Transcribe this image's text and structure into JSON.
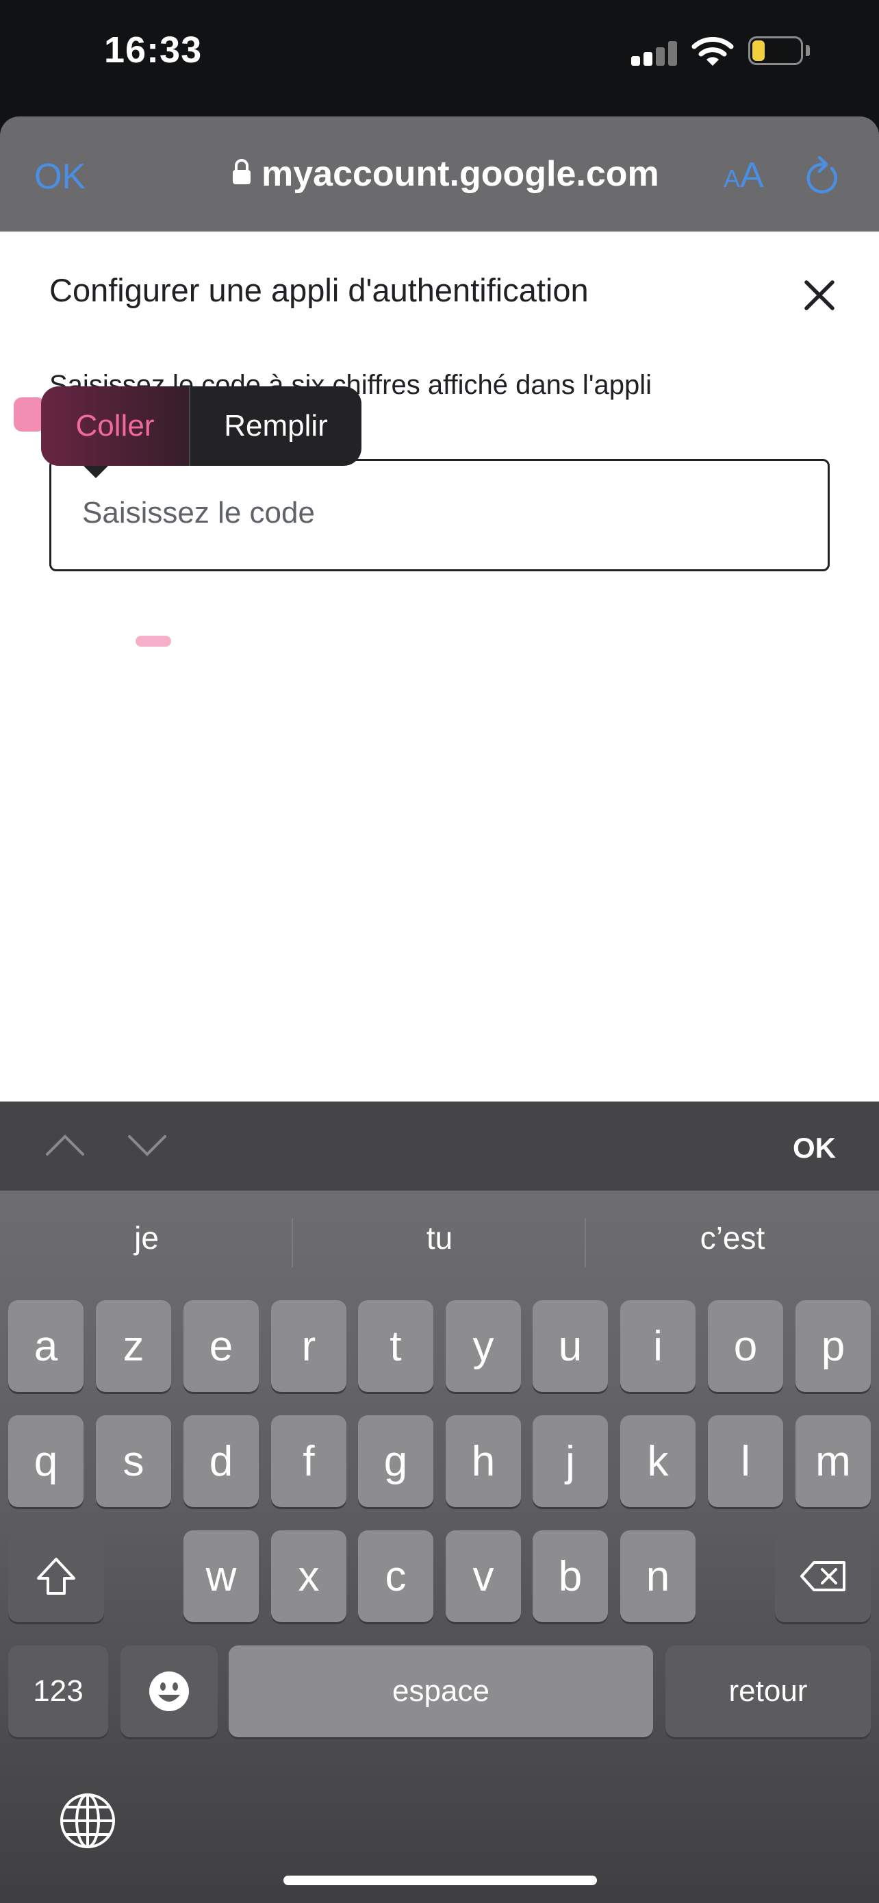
{
  "status_bar": {
    "time": "16:33",
    "battery_level": "8",
    "signal_bars_filled": 2,
    "signal_bars_total": 4
  },
  "browser": {
    "done_label": "OK",
    "url": "myaccount.google.com",
    "reader_label": "AA",
    "accent_color": "#4a8fe3"
  },
  "dialog": {
    "title": "Configurer une appli d'authentification",
    "description": "Saisissez le code à six chiffres affiché dans l'appli",
    "code_input": {
      "value": "",
      "placeholder": "Saisissez le code"
    }
  },
  "edit_menu": {
    "paste_label": "Coller",
    "autofill_label": "Remplir",
    "paste_color": "#f06aa0"
  },
  "accessory_bar": {
    "done_label": "OK"
  },
  "keyboard": {
    "suggestions": [
      "je",
      "tu",
      "c’est"
    ],
    "row1": [
      "a",
      "z",
      "e",
      "r",
      "t",
      "y",
      "u",
      "i",
      "o",
      "p"
    ],
    "row2": [
      "q",
      "s",
      "d",
      "f",
      "g",
      "h",
      "j",
      "k",
      "l",
      "m"
    ],
    "row3": [
      "w",
      "x",
      "c",
      "v",
      "b",
      "n"
    ],
    "numbers_label": "123",
    "space_label": "espace",
    "return_label": "retour"
  }
}
